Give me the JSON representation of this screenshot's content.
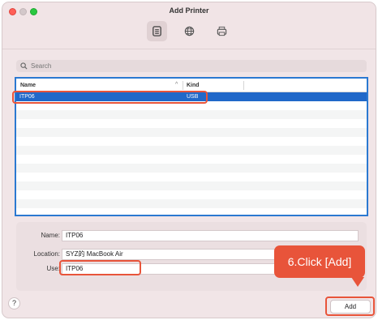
{
  "window": {
    "title": "Add Printer"
  },
  "toolbar": {
    "buttons": [
      {
        "icon": "default-printer-icon",
        "active": true
      },
      {
        "icon": "ip-globe-icon",
        "active": false
      },
      {
        "icon": "windows-printer-icon",
        "active": false
      }
    ]
  },
  "search": {
    "placeholder": "Search"
  },
  "list": {
    "columns": {
      "name": "Name",
      "kind": "Kind"
    },
    "rows": [
      {
        "name": "ITP06",
        "kind": "USB",
        "selected": true
      }
    ]
  },
  "form": {
    "name_label": "Name:",
    "name_value": "ITP06",
    "location_label": "Location:",
    "location_value": "SYZ的 MacBook Air",
    "use_label": "Use:",
    "use_value": "ITP06"
  },
  "callout": {
    "text": "6.Click [Add]"
  },
  "footer": {
    "help_label": "?",
    "add_label": "Add"
  },
  "colors": {
    "highlight": "#e8543a",
    "selection": "#2068c9",
    "focus_ring": "#2b79d1"
  }
}
